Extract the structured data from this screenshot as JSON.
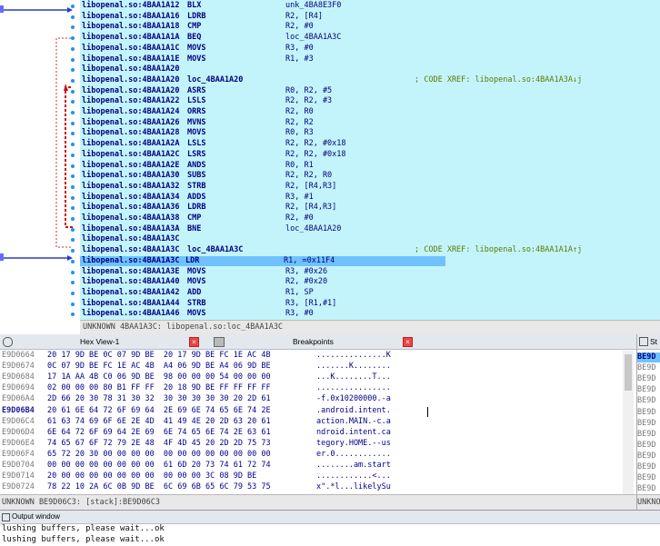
{
  "disasm": {
    "lines": [
      {
        "addr": "libopenal.so:4BAA1A12",
        "mnem": "BLX",
        "ops": "unk_4BA8E3F0",
        "comment": ""
      },
      {
        "addr": "libopenal.so:4BAA1A16",
        "mnem": "LDRB",
        "ops": "R2, [R4]",
        "comment": ""
      },
      {
        "addr": "libopenal.so:4BAA1A18",
        "mnem": "CMP",
        "ops": "R2, #0",
        "comment": ""
      },
      {
        "addr": "libopenal.so:4BAA1A1A",
        "mnem": "BEQ",
        "ops": "loc_4BAA1A3C",
        "comment": ""
      },
      {
        "addr": "libopenal.so:4BAA1A1C",
        "mnem": "MOVS",
        "ops": "R3, #0",
        "comment": ""
      },
      {
        "addr": "libopenal.so:4BAA1A1E",
        "mnem": "MOVS",
        "ops": "R1, #3",
        "comment": ""
      },
      {
        "addr": "libopenal.so:4BAA1A20",
        "mnem": "",
        "ops": "",
        "comment": ""
      },
      {
        "addr": "libopenal.so:4BAA1A20",
        "mnem": "loc_4BAA1A20",
        "ops": "",
        "comment": "; CODE XREF: libopenal.so:4BAA1A3A↓j"
      },
      {
        "addr": "libopenal.so:4BAA1A20",
        "mnem": "ASRS",
        "ops": "R0, R2, #5",
        "comment": ""
      },
      {
        "addr": "libopenal.so:4BAA1A22",
        "mnem": "LSLS",
        "ops": "R2, R2, #3",
        "comment": ""
      },
      {
        "addr": "libopenal.so:4BAA1A24",
        "mnem": "ORRS",
        "ops": "R2, R0",
        "comment": ""
      },
      {
        "addr": "libopenal.so:4BAA1A26",
        "mnem": "MVNS",
        "ops": "R2, R2",
        "comment": ""
      },
      {
        "addr": "libopenal.so:4BAA1A28",
        "mnem": "MOVS",
        "ops": "R0, R3",
        "comment": ""
      },
      {
        "addr": "libopenal.so:4BAA1A2A",
        "mnem": "LSLS",
        "ops": "R2, R2, #0x18",
        "comment": ""
      },
      {
        "addr": "libopenal.so:4BAA1A2C",
        "mnem": "LSRS",
        "ops": "R2, R2, #0x18",
        "comment": ""
      },
      {
        "addr": "libopenal.so:4BAA1A2E",
        "mnem": "ANDS",
        "ops": "R0, R1",
        "comment": ""
      },
      {
        "addr": "libopenal.so:4BAA1A30",
        "mnem": "SUBS",
        "ops": "R2, R2, R0",
        "comment": ""
      },
      {
        "addr": "libopenal.so:4BAA1A32",
        "mnem": "STRB",
        "ops": "R2, [R4,R3]",
        "comment": ""
      },
      {
        "addr": "libopenal.so:4BAA1A34",
        "mnem": "ADDS",
        "ops": "R3, #1",
        "comment": ""
      },
      {
        "addr": "libopenal.so:4BAA1A36",
        "mnem": "LDRB",
        "ops": "R2, [R4,R3]",
        "comment": ""
      },
      {
        "addr": "libopenal.so:4BAA1A38",
        "mnem": "CMP",
        "ops": "R2, #0",
        "comment": ""
      },
      {
        "addr": "libopenal.so:4BAA1A3A",
        "mnem": "BNE",
        "ops": "loc_4BAA1A20",
        "comment": ""
      },
      {
        "addr": "libopenal.so:4BAA1A3C",
        "mnem": "",
        "ops": "",
        "comment": ""
      },
      {
        "addr": "libopenal.so:4BAA1A3C",
        "mnem": "loc_4BAA1A3C",
        "ops": "",
        "comment": "; CODE XREF: libopenal.so:4BAA1A1A↑j"
      },
      {
        "addr": "libopenal.so:4BAA1A3C",
        "mnem": "LDR",
        "ops": "R1, =0x11F4",
        "comment": ""
      },
      {
        "addr": "libopenal.so:4BAA1A3E",
        "mnem": "MOVS",
        "ops": "R3, #0x26",
        "comment": ""
      },
      {
        "addr": "libopenal.so:4BAA1A40",
        "mnem": "MOVS",
        "ops": "R2, #0x20",
        "comment": ""
      },
      {
        "addr": "libopenal.so:4BAA1A42",
        "mnem": "ADD",
        "ops": "R1, SP",
        "comment": ""
      },
      {
        "addr": "libopenal.so:4BAA1A44",
        "mnem": "STRB",
        "ops": "R3, [R1,#1]",
        "comment": ""
      },
      {
        "addr": "libopenal.so:4BAA1A46",
        "mnem": "MOVS",
        "ops": "R3, #0",
        "comment": ""
      }
    ],
    "selected_index": 24,
    "status": "UNKNOWN 4BAA1A3C: libopenal.so:loc_4BAA1A3C"
  },
  "hexview": {
    "title": "Hex View-1",
    "rows": [
      {
        "addr": "E9D0664",
        "bytes": "20 17 9D BE 0C 07 9D BE  20 17 9D BE FC 1E AC 4B",
        "ascii": "...............K"
      },
      {
        "addr": "E9D0674",
        "bytes": "0C 07 9D BE FC 1E AC 4B  A4 06 9D BE A4 06 9D BE",
        "ascii": ".......K........"
      },
      {
        "addr": "E9D0684",
        "bytes": "17 1A AA 4B C0 06 9D BE  98 00 00 00 54 00 00 00",
        "ascii": "...K........T..."
      },
      {
        "addr": "E9D0694",
        "bytes": "02 00 00 00 80 B1 FF FF  20 18 9D BE FF FF FF FF",
        "ascii": "................"
      },
      {
        "addr": "E9D06A4",
        "bytes": "2D 66 20 30 78 31 30 32  30 30 30 30 30 20 2D 61",
        "ascii": "-f.0x10200000.-a"
      },
      {
        "addr": "E9D06B4",
        "bytes": "20 61 6E 64 72 6F 69 64  2E 69 6E 74 65 6E 74 2E",
        "ascii": ".android.intent."
      },
      {
        "addr": "E9D06C4",
        "bytes": "61 63 74 69 6F 6E 2E 4D  41 49 4E 20 2D 63 20 61",
        "ascii": "action.MAIN.-c.a"
      },
      {
        "addr": "E9D06D4",
        "bytes": "6E 64 72 6F 69 64 2E 69  6E 74 65 6E 74 2E 63 61",
        "ascii": "ndroid.intent.ca"
      },
      {
        "addr": "E9D06E4",
        "bytes": "74 65 67 6F 72 79 2E 48  4F 4D 45 20 2D 2D 75 73",
        "ascii": "tegory.HOME.--us"
      },
      {
        "addr": "E9D06F4",
        "bytes": "65 72 20 30 00 00 00 00  00 00 00 00 00 00 00 00",
        "ascii": "er.0............"
      },
      {
        "addr": "E9D0704",
        "bytes": "00 00 00 00 00 00 00 00  61 6D 20 73 74 61 72 74",
        "ascii": "........am.start"
      },
      {
        "addr": "E9D0714",
        "bytes": "20 00 00 00 00 00 00 00  00 00 00 3C 08 9D BE",
        "ascii": "............<..."
      },
      {
        "addr": "E9D0724",
        "bytes": "78 22 10 2A 6C 0B 9D BE  6C 69 6B 65 6C 79 53 75",
        "ascii": "x\".*l...likelySu"
      }
    ],
    "current_row": 5,
    "status": "UNKNOWN BE9D06C3: [stack]:BE9D06C3"
  },
  "breakpoints": {
    "title": "Breakpoints"
  },
  "stackview": {
    "title": "St",
    "rows": [
      "BE9D",
      "BE9D",
      "BE9D",
      "BE9D",
      "BE9D",
      "BE9D",
      "BE9D",
      "BE9D",
      "BE9D",
      "BE9D",
      "BE9D",
      "BE9D",
      "BE9D"
    ],
    "status": "UNKNO"
  },
  "output": {
    "title": "Output window",
    "lines": [
      "lushing buffers, please wait...ok",
      "lushing buffers, please wait...ok"
    ]
  }
}
